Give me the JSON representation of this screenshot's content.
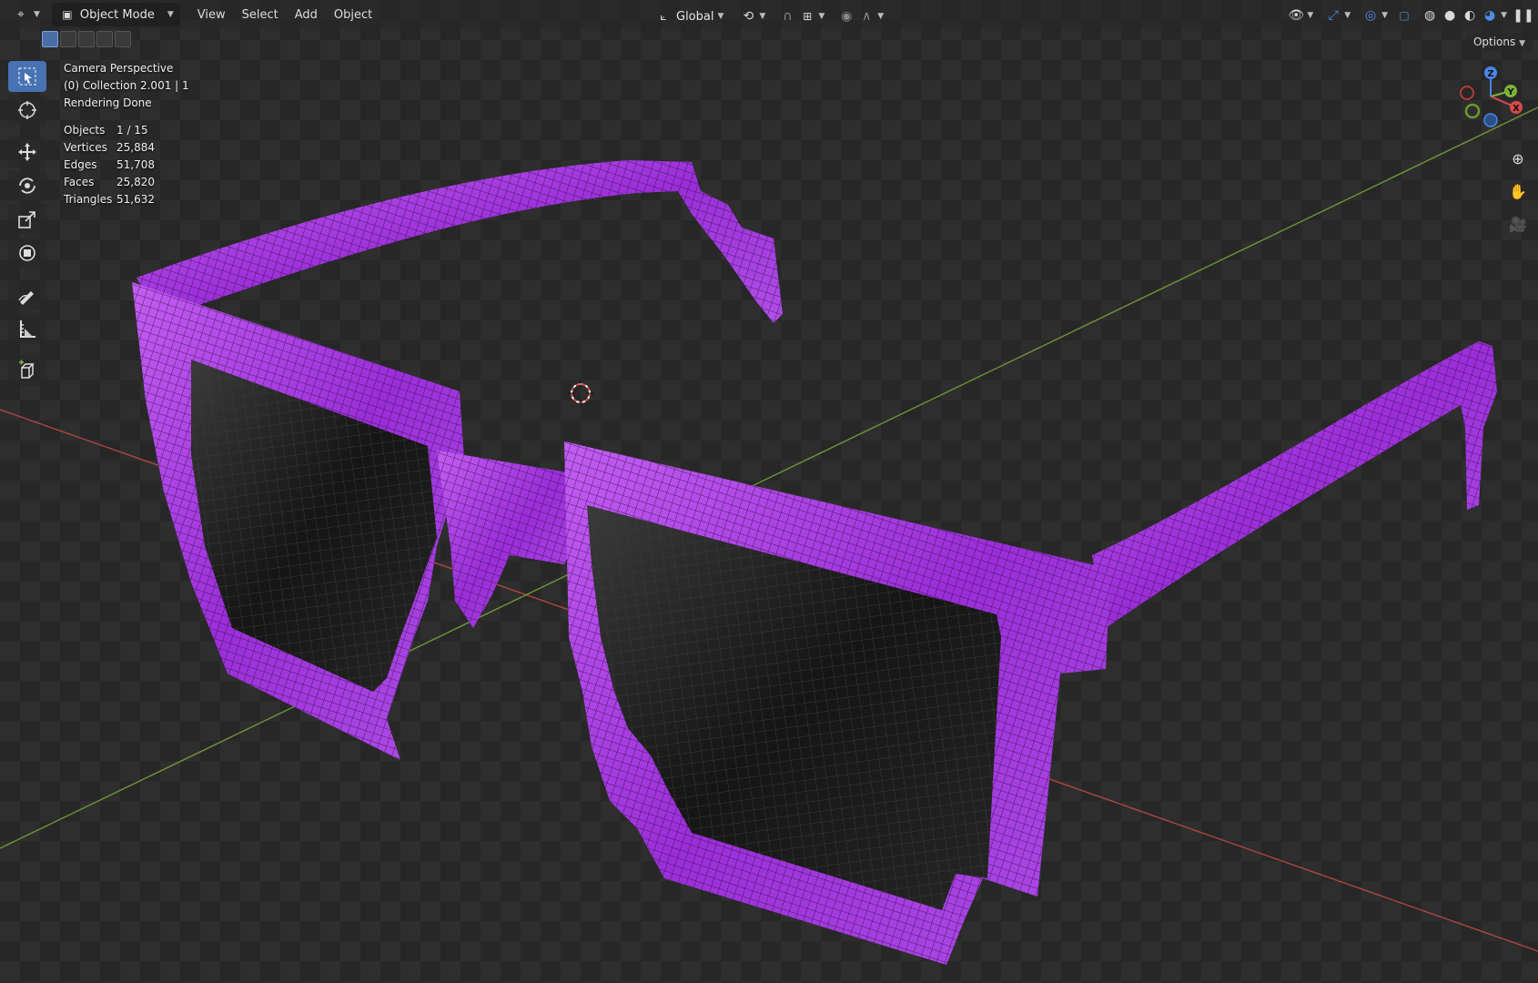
{
  "header": {
    "editor_type_icon": "3d-viewport-icon",
    "mode": "Object Mode",
    "menus": [
      "View",
      "Select",
      "Add",
      "Object"
    ],
    "orientation": "Global",
    "options_label": "Options"
  },
  "overlay": {
    "camera": "Camera Perspective",
    "collection": "(0) Collection 2.001 | 1",
    "status": "Rendering Done",
    "stats": [
      {
        "label": "Objects",
        "value": "1 / 15"
      },
      {
        "label": "Vertices",
        "value": "25,884"
      },
      {
        "label": "Edges",
        "value": "51,708"
      },
      {
        "label": "Faces",
        "value": "25,820"
      },
      {
        "label": "Triangles",
        "value": "51,632"
      }
    ]
  },
  "gizmo": {
    "x": "X",
    "y": "Y",
    "z": "Z"
  },
  "toolbar": {
    "tools": [
      "select-box",
      "cursor",
      "move",
      "rotate",
      "scale",
      "transform",
      "annotate",
      "measure",
      "add-cube"
    ]
  },
  "colors": {
    "frame": "#a43fe0",
    "frame_light": "#c060f0",
    "lens": "#1b1b1b",
    "x_axis": "#d84a4a",
    "y_axis": "#7bb33a",
    "z_axis": "#4a86e8",
    "active_tool": "#4772b3"
  }
}
